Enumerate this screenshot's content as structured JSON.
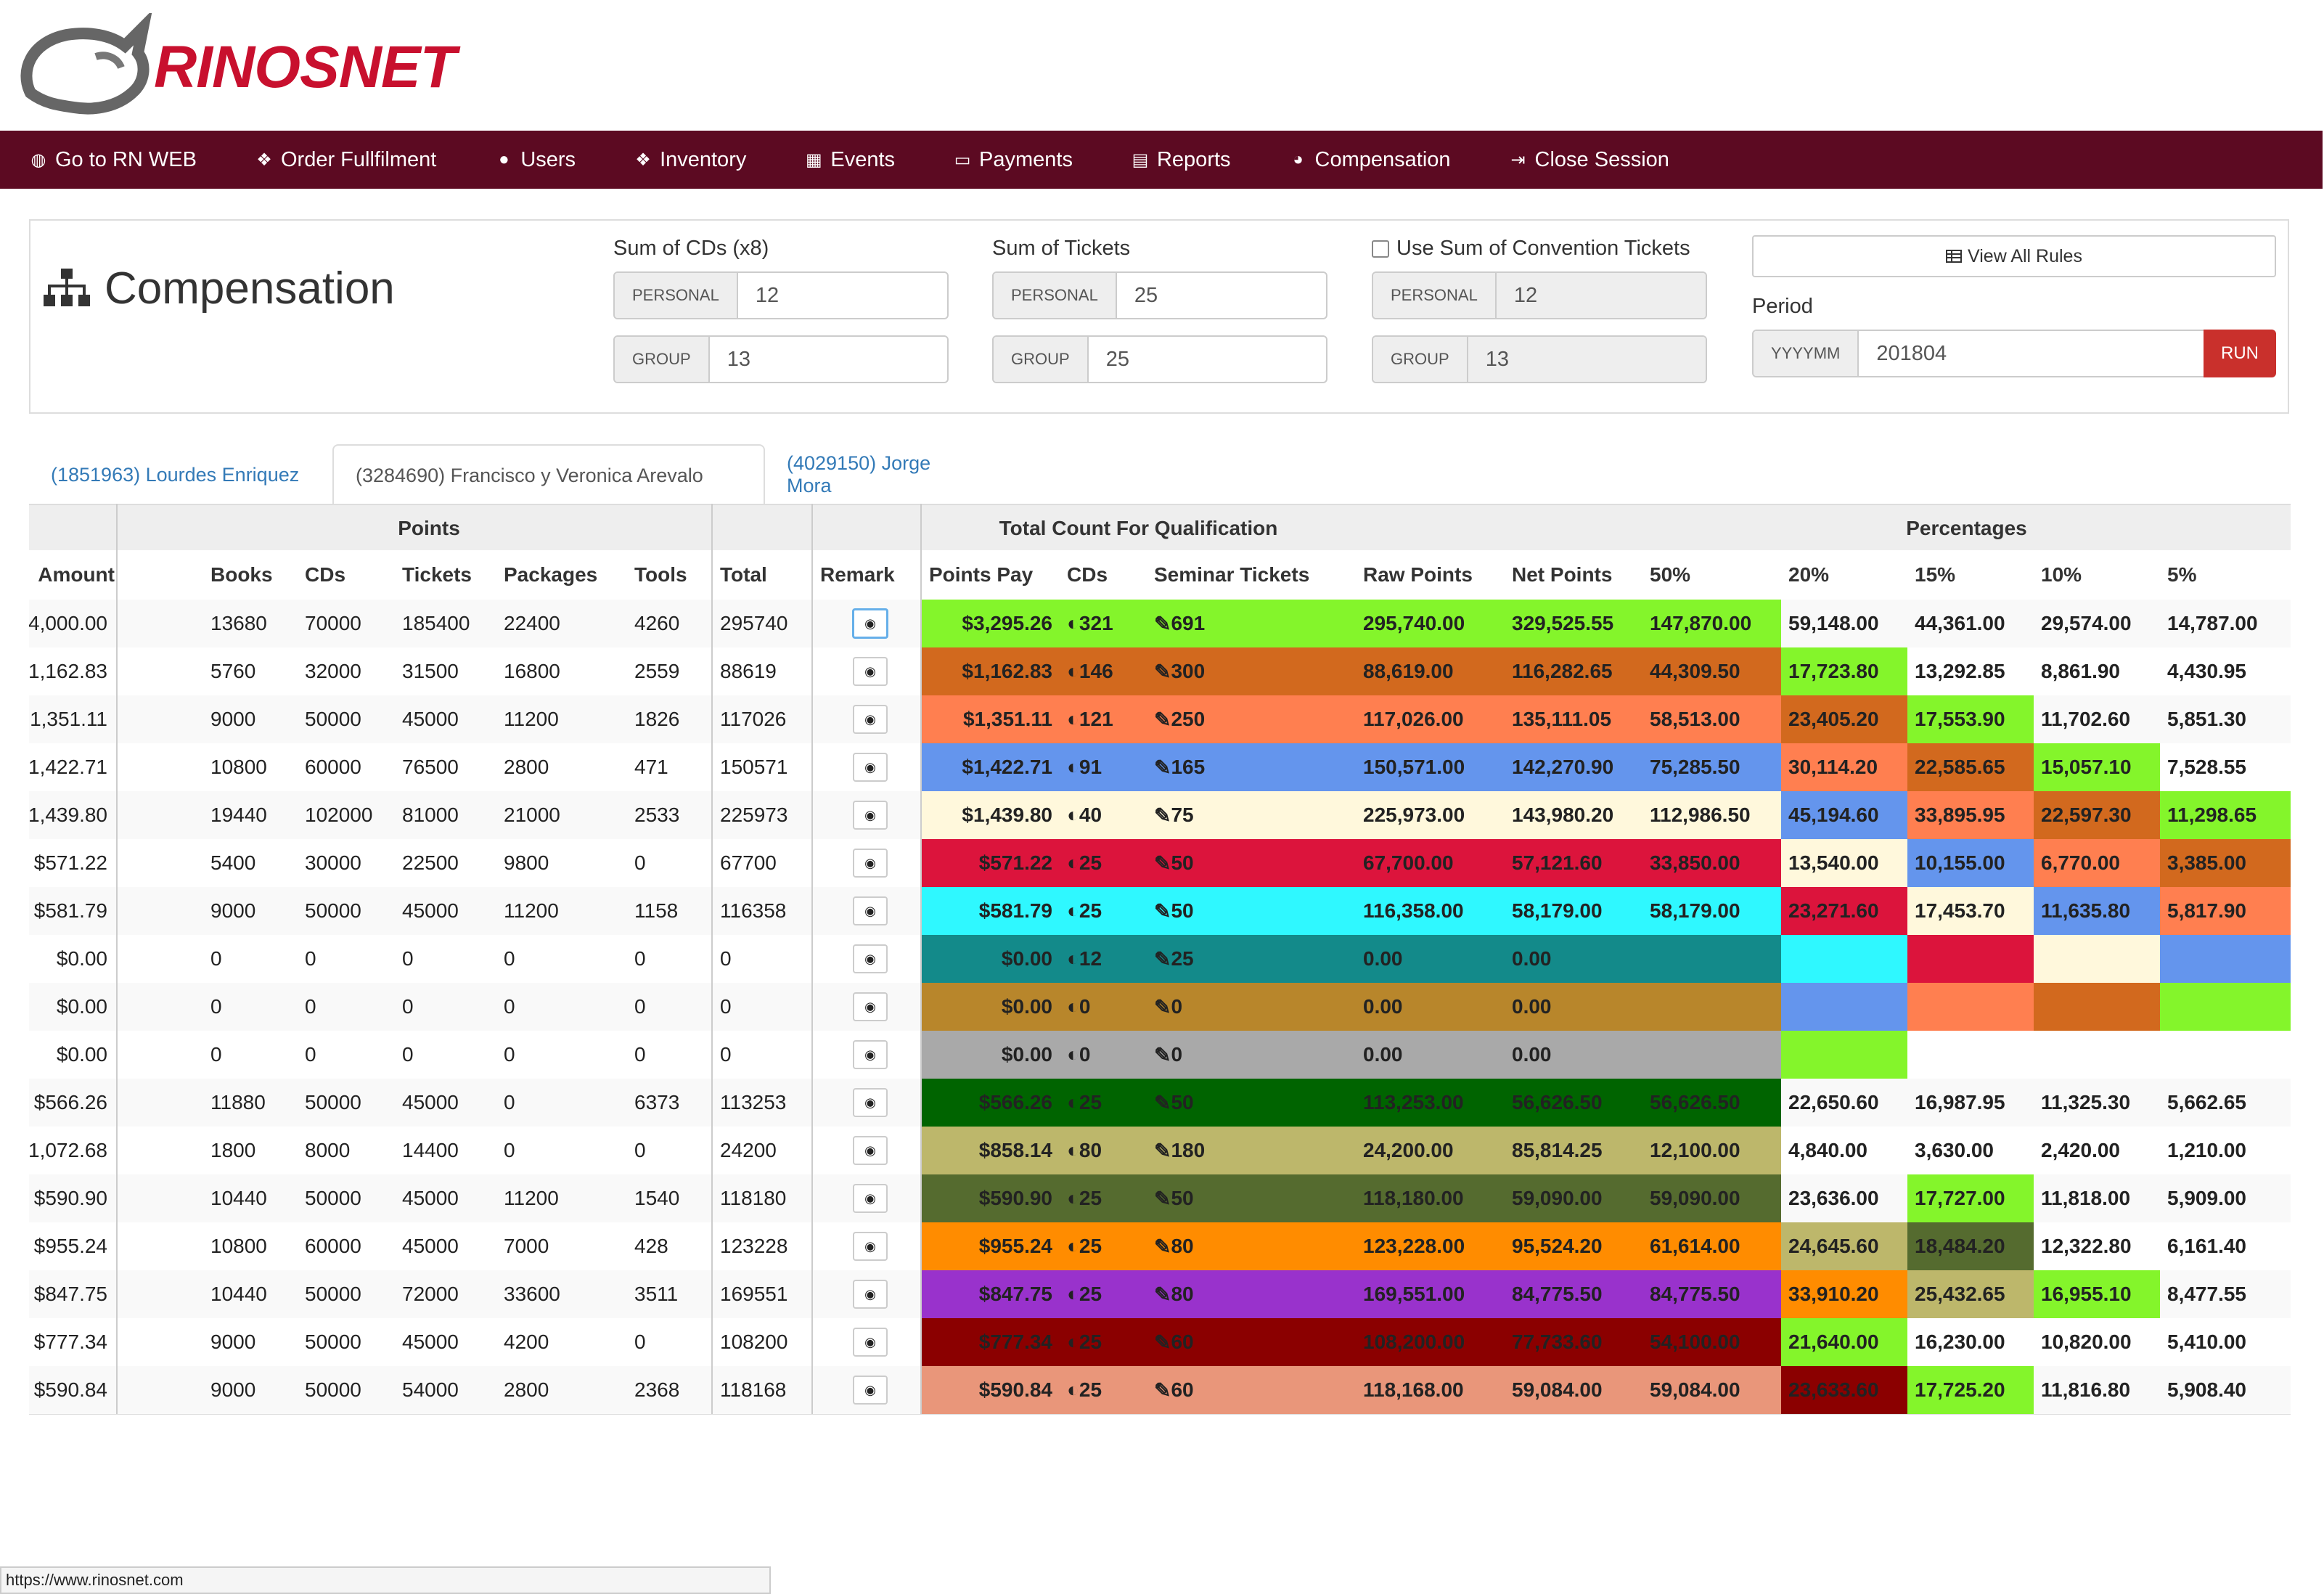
{
  "brand": {
    "name": "RINOSNET"
  },
  "nav": [
    {
      "label": "Go to RN WEB",
      "icon": "globe-icon"
    },
    {
      "label": "Order Fullfilment",
      "icon": "cubes-icon"
    },
    {
      "label": "Users",
      "icon": "user-icon"
    },
    {
      "label": "Inventory",
      "icon": "cubes-icon"
    },
    {
      "label": "Events",
      "icon": "calendar-icon"
    },
    {
      "label": "Payments",
      "icon": "money-icon"
    },
    {
      "label": "Reports",
      "icon": "book-icon"
    },
    {
      "label": "Compensation",
      "icon": "pie-chart-icon"
    },
    {
      "label": "Close Session",
      "icon": "sign-out-icon"
    }
  ],
  "page": {
    "title": "Compensation"
  },
  "cds": {
    "label": "Sum of CDs (x8)",
    "personal_label": "PERSONAL",
    "personal_value": "12",
    "group_label": "GROUP",
    "group_value": "13"
  },
  "tickets": {
    "label": "Sum of Tickets",
    "personal_label": "PERSONAL",
    "personal_value": "25",
    "group_label": "GROUP",
    "group_value": "25"
  },
  "convention": {
    "label": "Use Sum of Convention Tickets",
    "checked": false,
    "personal_label": "PERSONAL",
    "personal_value": "12",
    "group_label": "GROUP",
    "group_value": "13"
  },
  "rules_button": "View All Rules",
  "period": {
    "label": "Period",
    "addon": "YYYYMM",
    "value": "201804",
    "run": "RUN"
  },
  "tabs": [
    {
      "label": "(1851963) Lourdes Enriquez",
      "active": false
    },
    {
      "label": "(3284690) Francisco y Veronica Arevalo",
      "active": true
    },
    {
      "label": "(4029150) Jorge Mora",
      "active": false
    }
  ],
  "table": {
    "group_headers": {
      "points": "Points",
      "qualification": "Total Count For Qualification",
      "percentages": "Percentages"
    },
    "columns": [
      "Amount",
      "Books",
      "CDs",
      "Tickets",
      "Packages",
      "Tools",
      "Total",
      "Remark",
      "Points Pay",
      "CDs",
      "Seminar Tickets",
      "Raw Points",
      "Net Points",
      "50%",
      "20%",
      "15%",
      "10%",
      "5%"
    ],
    "rows": [
      {
        "amount": "4,000.00",
        "books": "13680",
        "cds": "70000",
        "tickets": "185400",
        "packages": "22400",
        "tools": "4260",
        "total": "295740",
        "pp": "$3,295.26",
        "qcds": "321",
        "qtix": "691",
        "raw": "295,740.00",
        "net": "329,525.55",
        "p50": "147,870.00",
        "p20": "59,148.00",
        "p15": "44,361.00",
        "p10": "29,574.00",
        "p5": "14,787.00",
        "color": "#84f52b",
        "c20": "",
        "c15": "",
        "c10": "",
        "c5": ""
      },
      {
        "amount": "1,162.83",
        "books": "5760",
        "cds": "32000",
        "tickets": "31500",
        "packages": "16800",
        "tools": "2559",
        "total": "88619",
        "pp": "$1,162.83",
        "qcds": "146",
        "qtix": "300",
        "raw": "88,619.00",
        "net": "116,282.65",
        "p50": "44,309.50",
        "p20": "17,723.80",
        "p15": "13,292.85",
        "p10": "8,861.90",
        "p5": "4,430.95",
        "color": "#d2691e",
        "c20": "#84f52b",
        "c15": "",
        "c10": "",
        "c5": ""
      },
      {
        "amount": "1,351.11",
        "books": "9000",
        "cds": "50000",
        "tickets": "45000",
        "packages": "11200",
        "tools": "1826",
        "total": "117026",
        "pp": "$1,351.11",
        "qcds": "121",
        "qtix": "250",
        "raw": "117,026.00",
        "net": "135,111.05",
        "p50": "58,513.00",
        "p20": "23,405.20",
        "p15": "17,553.90",
        "p10": "11,702.60",
        "p5": "5,851.30",
        "color": "#ff7f50",
        "c20": "#d2691e",
        "c15": "#84f52b",
        "c10": "",
        "c5": ""
      },
      {
        "amount": "1,422.71",
        "books": "10800",
        "cds": "60000",
        "tickets": "76500",
        "packages": "2800",
        "tools": "471",
        "total": "150571",
        "pp": "$1,422.71",
        "qcds": "91",
        "qtix": "165",
        "raw": "150,571.00",
        "net": "142,270.90",
        "p50": "75,285.50",
        "p20": "30,114.20",
        "p15": "22,585.65",
        "p10": "15,057.10",
        "p5": "7,528.55",
        "color": "#6495ed",
        "c20": "#ff7f50",
        "c15": "#d2691e",
        "c10": "#84f52b",
        "c5": ""
      },
      {
        "amount": "1,439.80",
        "books": "19440",
        "cds": "102000",
        "tickets": "81000",
        "packages": "21000",
        "tools": "2533",
        "total": "225973",
        "pp": "$1,439.80",
        "qcds": "40",
        "qtix": "75",
        "raw": "225,973.00",
        "net": "143,980.20",
        "p50": "112,986.50",
        "p20": "45,194.60",
        "p15": "33,895.95",
        "p10": "22,597.30",
        "p5": "11,298.65",
        "color": "#fff8dc",
        "c20": "#6495ed",
        "c15": "#ff7f50",
        "c10": "#d2691e",
        "c5": "#84f52b"
      },
      {
        "amount": "$571.22",
        "books": "5400",
        "cds": "30000",
        "tickets": "22500",
        "packages": "9800",
        "tools": "0",
        "total": "67700",
        "pp": "$571.22",
        "qcds": "25",
        "qtix": "50",
        "raw": "67,700.00",
        "net": "57,121.60",
        "p50": "33,850.00",
        "p20": "13,540.00",
        "p15": "10,155.00",
        "p10": "6,770.00",
        "p5": "3,385.00",
        "color": "#dc143c",
        "c20": "#fff8dc",
        "c15": "#6495ed",
        "c10": "#ff7f50",
        "c5": "#d2691e"
      },
      {
        "amount": "$581.79",
        "books": "9000",
        "cds": "50000",
        "tickets": "45000",
        "packages": "11200",
        "tools": "1158",
        "total": "116358",
        "pp": "$581.79",
        "qcds": "25",
        "qtix": "50",
        "raw": "116,358.00",
        "net": "58,179.00",
        "p50": "58,179.00",
        "p20": "23,271.60",
        "p15": "17,453.70",
        "p10": "11,635.80",
        "p5": "5,817.90",
        "color": "#2ff8ff",
        "c20": "#dc143c",
        "c15": "#fff8dc",
        "c10": "#6495ed",
        "c5": "#ff7f50"
      },
      {
        "amount": "$0.00",
        "books": "0",
        "cds": "0",
        "tickets": "0",
        "packages": "0",
        "tools": "0",
        "total": "0",
        "pp": "$0.00",
        "qcds": "12",
        "qtix": "25",
        "raw": "0.00",
        "net": "0.00",
        "p50": "",
        "p20": "",
        "p15": "",
        "p10": "",
        "p5": "",
        "color": "#138a8a",
        "c20": "#2ff8ff",
        "c15": "#dc143c",
        "c10": "#fff8dc",
        "c5": "#6495ed"
      },
      {
        "amount": "$0.00",
        "books": "0",
        "cds": "0",
        "tickets": "0",
        "packages": "0",
        "tools": "0",
        "total": "0",
        "pp": "$0.00",
        "qcds": "0",
        "qtix": "0",
        "raw": "0.00",
        "net": "0.00",
        "p50": "",
        "p20": "",
        "p15": "",
        "p10": "",
        "p5": "",
        "color": "#b8862b",
        "c20": "#6495ed",
        "c15": "#ff7f50",
        "c10": "#d2691e",
        "c5": "#84f52b"
      },
      {
        "amount": "$0.00",
        "books": "0",
        "cds": "0",
        "tickets": "0",
        "packages": "0",
        "tools": "0",
        "total": "0",
        "pp": "$0.00",
        "qcds": "0",
        "qtix": "0",
        "raw": "0.00",
        "net": "0.00",
        "p50": "",
        "p20": "",
        "p15": "",
        "p10": "",
        "p5": "",
        "color": "#a9a9a9",
        "c20": "#84f52b",
        "c15": "",
        "c10": "",
        "c5": ""
      },
      {
        "amount": "$566.26",
        "books": "11880",
        "cds": "50000",
        "tickets": "45000",
        "packages": "0",
        "tools": "6373",
        "total": "113253",
        "pp": "$566.26",
        "qcds": "25",
        "qtix": "50",
        "raw": "113,253.00",
        "net": "56,626.50",
        "p50": "56,626.50",
        "p20": "22,650.60",
        "p15": "16,987.95",
        "p10": "11,325.30",
        "p5": "5,662.65",
        "color": "#006400",
        "c20": "",
        "c15": "",
        "c10": "",
        "c5": ""
      },
      {
        "amount": "1,072.68",
        "books": "1800",
        "cds": "8000",
        "tickets": "14400",
        "packages": "0",
        "tools": "0",
        "total": "24200",
        "pp": "$858.14",
        "qcds": "80",
        "qtix": "180",
        "raw": "24,200.00",
        "net": "85,814.25",
        "p50": "12,100.00",
        "p20": "4,840.00",
        "p15": "3,630.00",
        "p10": "2,420.00",
        "p5": "1,210.00",
        "color": "#bdb76b",
        "c20": "",
        "c15": "",
        "c10": "",
        "c5": ""
      },
      {
        "amount": "$590.90",
        "books": "10440",
        "cds": "50000",
        "tickets": "45000",
        "packages": "11200",
        "tools": "1540",
        "total": "118180",
        "pp": "$590.90",
        "qcds": "25",
        "qtix": "50",
        "raw": "118,180.00",
        "net": "59,090.00",
        "p50": "59,090.00",
        "p20": "23,636.00",
        "p15": "17,727.00",
        "p10": "11,818.00",
        "p5": "5,909.00",
        "color": "#556b2f",
        "c20": "",
        "c15": "#84f52b",
        "c10": "",
        "c5": ""
      },
      {
        "amount": "$955.24",
        "books": "10800",
        "cds": "60000",
        "tickets": "45000",
        "packages": "7000",
        "tools": "428",
        "total": "123228",
        "pp": "$955.24",
        "qcds": "25",
        "qtix": "80",
        "raw": "123,228.00",
        "net": "95,524.20",
        "p50": "61,614.00",
        "p20": "24,645.60",
        "p15": "18,484.20",
        "p10": "12,322.80",
        "p5": "6,161.40",
        "color": "#ff8c00",
        "c20": "#bdb76b",
        "c15": "#556b2f",
        "c10": "",
        "c5": ""
      },
      {
        "amount": "$847.75",
        "books": "10440",
        "cds": "50000",
        "tickets": "72000",
        "packages": "33600",
        "tools": "3511",
        "total": "169551",
        "pp": "$847.75",
        "qcds": "25",
        "qtix": "80",
        "raw": "169,551.00",
        "net": "84,775.50",
        "p50": "84,775.50",
        "p20": "33,910.20",
        "p15": "25,432.65",
        "p10": "16,955.10",
        "p5": "8,477.55",
        "color": "#9932cc",
        "c20": "#ff8c00",
        "c15": "#bdb76b",
        "c10": "#84f52b",
        "c5": ""
      },
      {
        "amount": "$777.34",
        "books": "9000",
        "cds": "50000",
        "tickets": "45000",
        "packages": "4200",
        "tools": "0",
        "total": "108200",
        "pp": "$777.34",
        "qcds": "25",
        "qtix": "60",
        "raw": "108,200.00",
        "net": "77,733.60",
        "p50": "54,100.00",
        "p20": "21,640.00",
        "p15": "16,230.00",
        "p10": "10,820.00",
        "p5": "5,410.00",
        "color": "#8b0000",
        "c20": "#84f52b",
        "c15": "",
        "c10": "",
        "c5": ""
      },
      {
        "amount": "$590.84",
        "books": "9000",
        "cds": "50000",
        "tickets": "54000",
        "packages": "2800",
        "tools": "2368",
        "total": "118168",
        "pp": "$590.84",
        "qcds": "25",
        "qtix": "60",
        "raw": "118,168.00",
        "net": "59,084.00",
        "p50": "59,084.00",
        "p20": "23,633.60",
        "p15": "17,725.20",
        "p10": "11,816.80",
        "p5": "5,908.40",
        "color": "#e9967a",
        "c20": "#8b0000",
        "c15": "#84f52b",
        "c10": "",
        "c5": ""
      }
    ]
  },
  "status_url": "https://www.rinosnet.com"
}
